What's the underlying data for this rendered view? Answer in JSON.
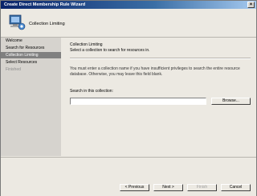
{
  "window": {
    "title": "Create Direct Membership Rule Wizard",
    "close_glyph": "×"
  },
  "header": {
    "title": "Collection Limiting",
    "icon": "computer-monitor-icon"
  },
  "sidebar": {
    "items": [
      {
        "label": "Welcome",
        "state": "normal"
      },
      {
        "label": "Search for Resources",
        "state": "normal"
      },
      {
        "label": "Collection Limiting",
        "state": "active"
      },
      {
        "label": "Select Resources",
        "state": "normal"
      },
      {
        "label": "Finished",
        "state": "disabled"
      }
    ]
  },
  "content": {
    "title": "Collection Limiting",
    "description": "Select a collection to search for resources in.",
    "paragraph": "You must enter a collection name if you have insufficient privileges to search the entire resource database. Otherwise, you may leave this field blank.",
    "search_label": "Search in this collection:",
    "search_value": "",
    "browse_label": "Browse..."
  },
  "footer": {
    "previous_label": "< Previous",
    "next_label": "Next >",
    "finish_label": "Finish",
    "cancel_label": "Cancel"
  },
  "colors": {
    "title_gradient_start": "#0a246a",
    "active_nav": "#808080",
    "sidebar_bg": "#d6d3ce"
  }
}
